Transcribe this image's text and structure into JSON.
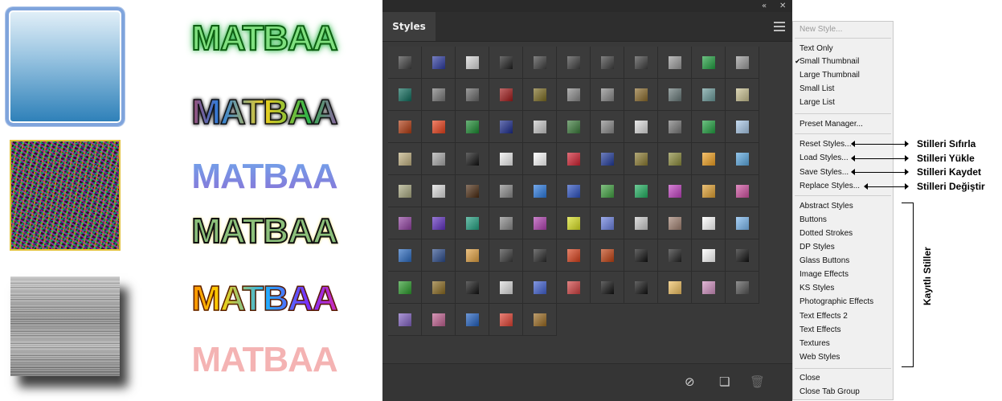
{
  "samples": {
    "words": [
      "MATBAA",
      "MATBAA",
      "MATBAA",
      "MATBAA",
      "MATBAA",
      "MATBAA"
    ]
  },
  "panel": {
    "tab_label": "Styles",
    "collapse_icon": "double-chevron-icon",
    "close_icon": "close-icon",
    "menu_icon": "hamburger-menu-icon",
    "bottom_icons": [
      "clear-style-icon",
      "new-style-icon",
      "trash-icon"
    ],
    "swatch_rows": [
      [
        "#3f3f3f",
        "#2c3aa0",
        "#d8d8d8",
        "#202020",
        "#3f3f3f",
        "#3f3f3f",
        "#3f3f3f",
        "#3f3f3f",
        "#9a9a9a",
        "#20a040",
        "#9a9a9a"
      ],
      [
        "#0d6a5a",
        "#777777",
        "#666666",
        "#a01818",
        "#7a6a20",
        "#888888",
        "#888888",
        "#8a6a2a",
        "#667777",
        "#6a9a9a",
        "#c8c090"
      ],
      [
        "#b03a10",
        "#e8401a",
        "#1a8a30",
        "#1a2a8a",
        "#c8c8c8",
        "#3a7a3a",
        "#888888",
        "#dddddd",
        "#777777",
        "#20a040",
        "#a8c8e8"
      ],
      [
        "#c0b080",
        "#a8a8a8",
        "#111111",
        "#eeeeee",
        "#ffffff",
        "#d02030",
        "#203a9a",
        "#8a7a30",
        "#8a8a3a",
        "#f0a020",
        "#5aa8e0"
      ],
      [
        "#a8a880",
        "#dddddd",
        "#4a2a10",
        "#888888",
        "#2a7ae0",
        "#2a50c0",
        "#40a040",
        "#20b060",
        "#c040c0",
        "#e0a030",
        "#d050a0"
      ],
      [
        "#9040a0",
        "#6030c0",
        "#20a080",
        "#888888",
        "#b040b0",
        "#d8e020",
        "#6a80e0",
        "#cccccc",
        "#a08070",
        "#ffffff",
        "#7ab8f0"
      ],
      [
        "#2a6ac0",
        "#2a4a8a",
        "#e0a040",
        "#3a3a3a",
        "#2a2a2a",
        "#d8401a",
        "#c04010",
        "#111111",
        "#222222",
        "#ffffff",
        "#111111"
      ],
      [
        "#2a9a2a",
        "#8a6a20",
        "#111111",
        "#dddddd",
        "#4060d0",
        "#d04040",
        "#111111",
        "#111111",
        "#f0c060",
        "#d090c0",
        "#555555"
      ],
      [
        "#8060c0",
        "#c06090",
        "#2060c0",
        "#e04030",
        "#9a6a20"
      ]
    ]
  },
  "menu": {
    "items": [
      {
        "label": "New Style...",
        "disabled": true
      },
      {
        "label": "Text Only"
      },
      {
        "label": "Small Thumbnail",
        "checked": true
      },
      {
        "label": "Large Thumbnail"
      },
      {
        "label": "Small List"
      },
      {
        "label": "Large List"
      },
      {
        "label": "Preset Manager..."
      },
      {
        "label": "Reset Styles..."
      },
      {
        "label": "Load Styles..."
      },
      {
        "label": "Save Styles..."
      },
      {
        "label": "Replace Styles..."
      },
      {
        "label": "Abstract Styles"
      },
      {
        "label": "Buttons"
      },
      {
        "label": "Dotted Strokes"
      },
      {
        "label": "DP Styles"
      },
      {
        "label": "Glass Buttons"
      },
      {
        "label": "Image Effects"
      },
      {
        "label": "KS Styles"
      },
      {
        "label": "Photographic Effects"
      },
      {
        "label": "Text Effects 2"
      },
      {
        "label": "Text Effects"
      },
      {
        "label": "Textures"
      },
      {
        "label": "Web Styles"
      },
      {
        "label": "Close"
      },
      {
        "label": "Close Tab Group"
      }
    ]
  },
  "annotations": {
    "reset": "Stilleri Sıfırla",
    "load": "Stilleri Yükle",
    "save": "Stilleri Kaydet",
    "replace": "Stilleri Değiştir",
    "saved_styles": "Kayıtlı Stiller"
  }
}
